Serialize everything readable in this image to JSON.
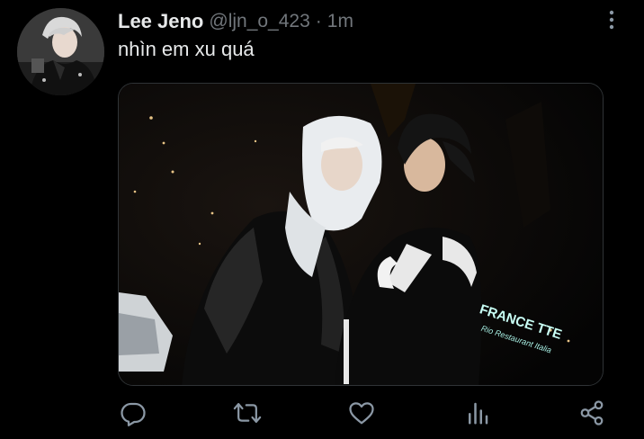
{
  "tweet": {
    "display_name": "Lee Jeno",
    "handle": "@ljn_o_423",
    "separator": "·",
    "time": "1m",
    "text": "nhìn em xu quá"
  },
  "media": {
    "sign_text": "FRANCE TTE",
    "sign_subtext": "Rio  Restaurant  Italia"
  },
  "icons": {
    "avatar": "avatar-image",
    "more": "more-vertical-icon",
    "reply": "reply-icon",
    "retweet": "retweet-icon",
    "like": "heart-icon",
    "analytics": "analytics-icon",
    "share": "share-icon"
  },
  "colors": {
    "background": "#000000",
    "text_primary": "#e7e9ea",
    "text_secondary": "#71767b",
    "icon": "#8b98a5"
  }
}
